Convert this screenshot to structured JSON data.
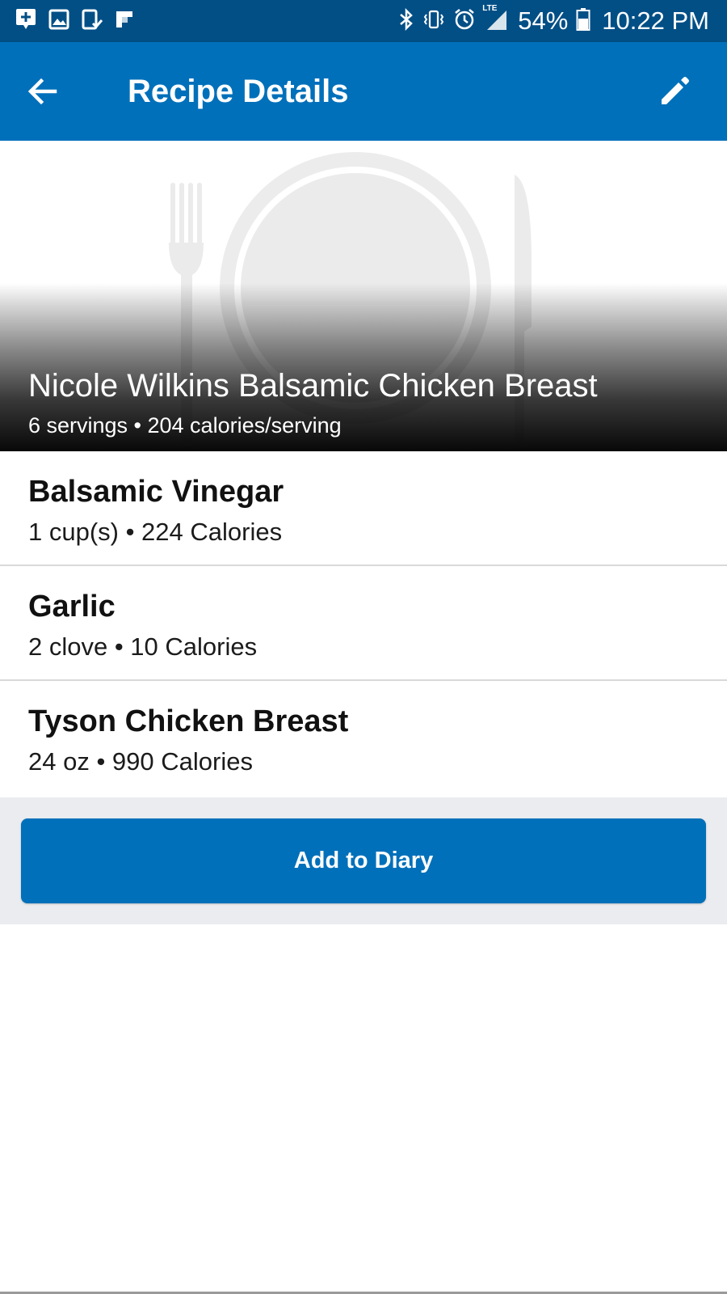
{
  "status_bar": {
    "left_icons": [
      "message-icon",
      "gallery-icon",
      "tablet-check-icon",
      "flipboard-icon"
    ],
    "right_icons": [
      "bluetooth-icon",
      "vibrate-icon",
      "alarm-icon",
      "lte-signal-icon",
      "battery-icon"
    ],
    "network_label": "LTE",
    "battery_percent": "54%",
    "time": "10:22 PM",
    "background_color": "#024f86"
  },
  "app_bar": {
    "title": "Recipe Details",
    "back_icon": "arrow-back-icon",
    "edit_icon": "pencil-icon",
    "background_color": "#0170ba"
  },
  "recipe": {
    "name": "Nicole Wilkins Balsamic Chicken Breast",
    "meta": "6 servings • 204 calories/serving",
    "placeholder_art": "plate-fork-knife-icon"
  },
  "ingredients": [
    {
      "name": "Balsamic Vinegar",
      "detail": "1 cup(s) • 224 Calories"
    },
    {
      "name": "Garlic",
      "detail": "2 clove • 10 Calories"
    },
    {
      "name": "Tyson Chicken Breast",
      "detail": "24 oz • 990 Calories"
    }
  ],
  "actions": {
    "add_label": "Add to Diary",
    "button_color": "#0170ba"
  }
}
